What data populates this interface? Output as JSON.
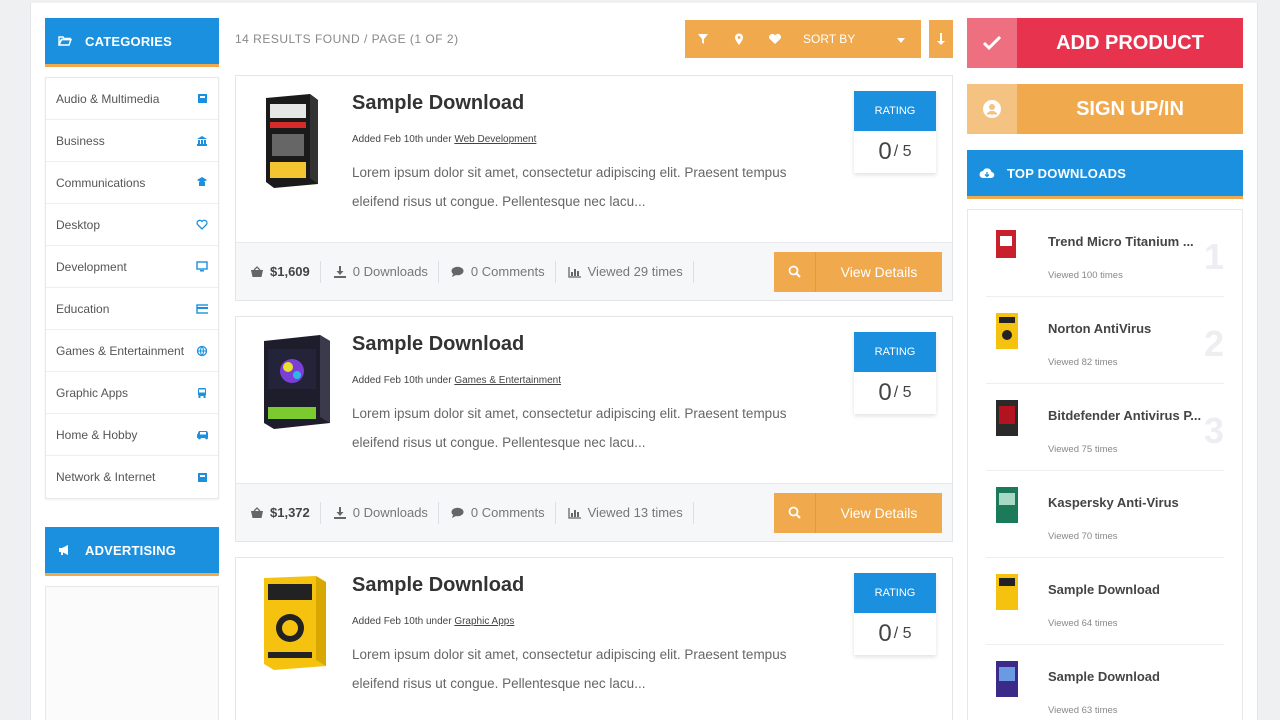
{
  "categories": {
    "title": "CATEGORIES",
    "items": [
      {
        "label": "Audio & Multimedia",
        "icon": "square-icon"
      },
      {
        "label": "Business",
        "icon": "building-icon"
      },
      {
        "label": "Communications",
        "icon": "chat-icon"
      },
      {
        "label": "Desktop",
        "icon": "heart-icon"
      },
      {
        "label": "Development",
        "icon": "monitor-icon"
      },
      {
        "label": "Education",
        "icon": "card-icon"
      },
      {
        "label": "Games & Entertainment",
        "icon": "globe-icon"
      },
      {
        "label": "Graphic Apps",
        "icon": "bus-icon"
      },
      {
        "label": "Home & Hobby",
        "icon": "car-icon"
      },
      {
        "label": "Network & Internet",
        "icon": "square-icon"
      }
    ]
  },
  "advertising": {
    "title": "ADVERTISING"
  },
  "results": {
    "text": "14 RESULTS FOUND / PAGE (1 OF 2)"
  },
  "toolbar": {
    "sort_label": "SORT BY"
  },
  "listings": [
    {
      "title": "Sample Download",
      "meta_prefix": "Added Feb 10th under",
      "category": "Web Development",
      "desc_line1": "Lorem ipsum dolor sit amet, consectetur adipiscing elit. Praesent tempus",
      "desc_line2": "eleifend risus ut congue. Pellentesque nec lacu...",
      "rating_label": "RATING",
      "rating_value": "0",
      "rating_outof": "/ 5",
      "price": "$1,609",
      "downloads": "0 Downloads",
      "comments": "0 Comments",
      "viewed": "Viewed 29 times",
      "details_label": "View Details"
    },
    {
      "title": "Sample Download",
      "meta_prefix": "Added Feb 10th under",
      "category": "Games & Entertainment",
      "desc_line1": "Lorem ipsum dolor sit amet, consectetur adipiscing elit. Praesent tempus",
      "desc_line2": "eleifend risus ut congue. Pellentesque nec lacu...",
      "rating_label": "RATING",
      "rating_value": "0",
      "rating_outof": "/ 5",
      "price": "$1,372",
      "downloads": "0 Downloads",
      "comments": "0 Comments",
      "viewed": "Viewed 13 times",
      "details_label": "View Details"
    },
    {
      "title": "Sample Download",
      "meta_prefix": "Added Feb 10th under",
      "category": "Graphic Apps",
      "desc_line1": "Lorem ipsum dolor sit amet, consectetur adipiscing elit. Praesent tempus",
      "desc_line2": "eleifend risus ut congue. Pellentesque nec lacu...",
      "rating_label": "RATING",
      "rating_value": "0",
      "rating_outof": "/ 5"
    }
  ],
  "actions": {
    "add_product": "ADD PRODUCT",
    "sign_up": "SIGN UP/IN"
  },
  "top_downloads": {
    "title": "TOP DOWNLOADS",
    "items": [
      {
        "title": "Trend Micro Titanium ...",
        "views": "Viewed 100 times",
        "rank": "1"
      },
      {
        "title": "Norton AntiVirus",
        "views": "Viewed 82 times",
        "rank": "2"
      },
      {
        "title": "Bitdefender Antivirus P...",
        "views": "Viewed 75 times",
        "rank": "3"
      },
      {
        "title": "Kaspersky Anti-Virus",
        "views": "Viewed 70 times",
        "rank": ""
      },
      {
        "title": "Sample Download",
        "views": "Viewed 64 times",
        "rank": ""
      },
      {
        "title": "Sample Download",
        "views": "Viewed 63 times",
        "rank": ""
      }
    ]
  },
  "colors": {
    "blue": "#1b90de",
    "orange": "#f0a94c",
    "red": "#e8334e"
  }
}
